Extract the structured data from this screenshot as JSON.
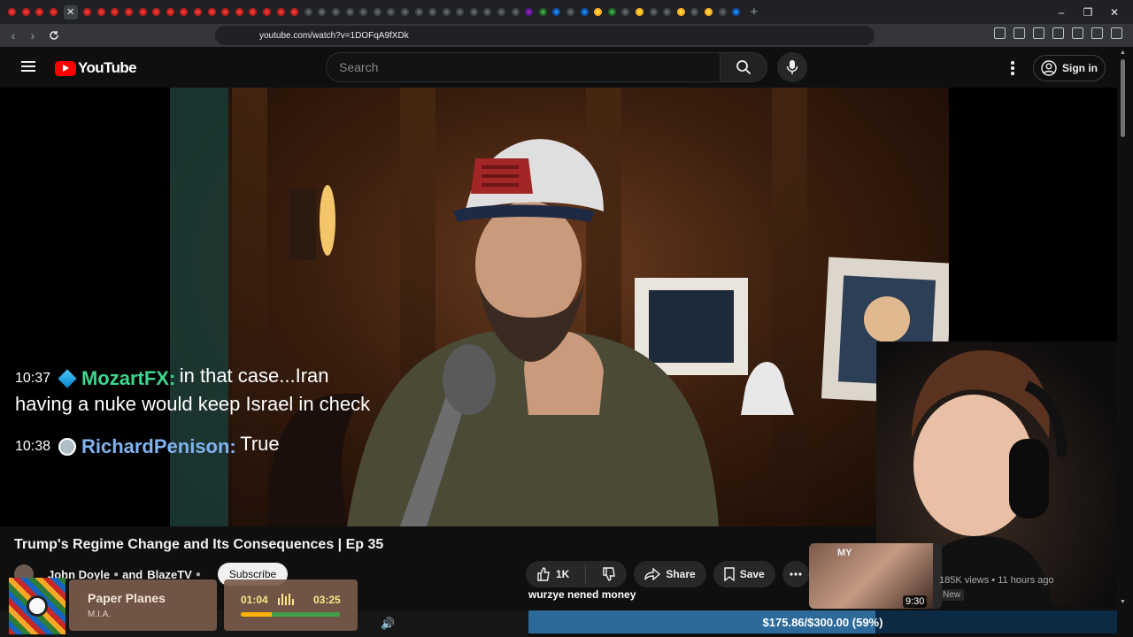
{
  "browser": {
    "url": "youtube.com/watch?v=1DOFqA9fXDk",
    "new_tab_symbol": "+",
    "window_controls": [
      "–",
      "❐",
      "✕"
    ],
    "active_tab_close": "✕"
  },
  "youtube": {
    "logo_text": "YouTube",
    "search_placeholder": "Search",
    "sign_in_label": "Sign in"
  },
  "chat": {
    "messages": [
      {
        "time": "10:37",
        "user": "MozartFX:",
        "user_color": "#3dd68c",
        "text": "in that case...Iran having a nuke would keep Israel in check"
      },
      {
        "time": "10:38",
        "user": "RichardPenison:",
        "user_color": "#7fb3f0",
        "text": "True"
      }
    ]
  },
  "video": {
    "title": "Trump's Regime Change and Its Consequences | Ep 35",
    "channel": "John Doyle",
    "collab_join": "and",
    "channel2": "BlazeTV",
    "subscribe_label": "Subscribe",
    "like_count": "1K",
    "share_label": "Share",
    "save_label": "Save"
  },
  "recommendation": {
    "title_fragment": "MY",
    "duration": "9:30",
    "meta": "185K views • 11 hours ago",
    "badge": "New"
  },
  "donation": {
    "username": "wurzye nened money",
    "goal_text": "$175.86/$300.00 (59%)",
    "progress": 0.59,
    "bar_color": "#2d6a99"
  },
  "music": {
    "song": "Paper Planes",
    "artist": "M.I.A.",
    "elapsed": "01:04",
    "total": "03:25",
    "progress": 0.31
  }
}
